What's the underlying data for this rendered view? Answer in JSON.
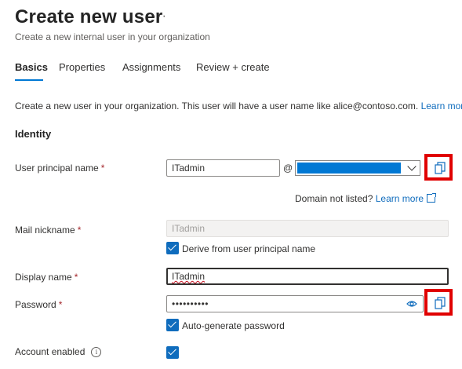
{
  "header": {
    "title": "Create new user",
    "more_label": "···",
    "subtitle": "Create a new internal user in your organization"
  },
  "tabs": [
    {
      "label": "Basics",
      "active": true
    },
    {
      "label": "Properties",
      "active": false
    },
    {
      "label": "Assignments",
      "active": false
    },
    {
      "label": "Review + create",
      "active": false
    }
  ],
  "intro": {
    "text": "Create a new user in your organization. This user will have a user name like alice@contoso.com.",
    "link": "Learn more"
  },
  "identity": {
    "section_title": "Identity",
    "upn": {
      "label": "User principal name",
      "value": "ITadmin",
      "at": "@",
      "domain_value": ""
    },
    "domain_hint": {
      "text": "Domain not listed?",
      "link": "Learn more"
    },
    "mail_nickname": {
      "label": "Mail nickname",
      "value": "ITadmin",
      "derive_label": "Derive from user principal name",
      "derive_checked": true
    },
    "display_name": {
      "label": "Display name",
      "value": "ITadmin"
    },
    "password": {
      "label": "Password",
      "value": "••••••••••",
      "auto_label": "Auto-generate password",
      "auto_checked": true
    },
    "account_enabled": {
      "label": "Account enabled",
      "info": "i",
      "checked": true
    },
    "required_mark": "*"
  },
  "colors": {
    "accent": "#0f6cbd",
    "highlight": "#e00000",
    "required": "#a4262c"
  }
}
